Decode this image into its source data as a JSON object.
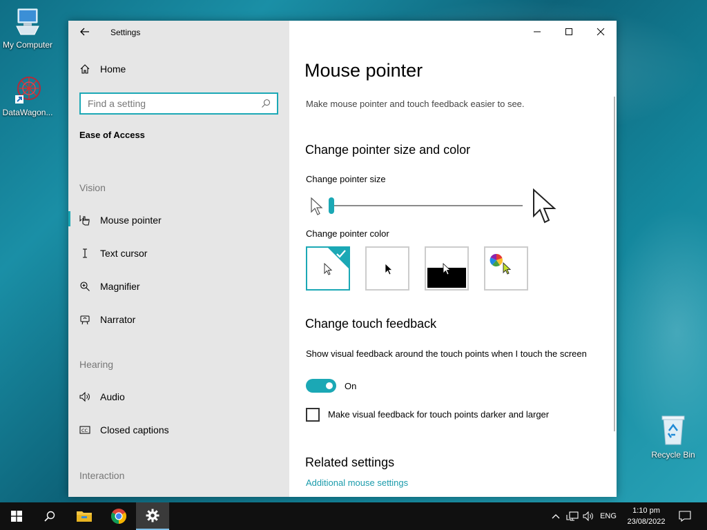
{
  "desktop": {
    "icons": [
      {
        "label": "My Computer"
      },
      {
        "label": "DataWagon..."
      },
      {
        "label": "Recycle Bin"
      }
    ]
  },
  "window": {
    "app_title": "Settings",
    "sidebar": {
      "home_label": "Home",
      "search_placeholder": "Find a setting",
      "section_title": "Ease of Access",
      "groups": {
        "vision": "Vision",
        "hearing": "Hearing",
        "interaction": "Interaction"
      },
      "items": {
        "mouse_pointer": "Mouse pointer",
        "text_cursor": "Text cursor",
        "magnifier": "Magnifier",
        "narrator": "Narrator",
        "audio": "Audio",
        "closed_captions": "Closed captions"
      },
      "selected_item": "Mouse pointer"
    },
    "content": {
      "title": "Mouse pointer",
      "description": "Make mouse pointer and touch feedback easier to see.",
      "size_color_heading": "Change pointer size and color",
      "size_label": "Change pointer size",
      "size_level": 0.0,
      "color_label": "Change pointer color",
      "color_options": [
        "white",
        "black",
        "inverted",
        "custom"
      ],
      "selected_color": "white",
      "touch_heading": "Change touch feedback",
      "touch_desc": "Show visual feedback around the touch points when I touch the screen",
      "toggle_state": "On",
      "toggle_on": true,
      "checkbox_label": "Make visual feedback for touch points darker and larger",
      "checkbox_checked": false,
      "related_heading": "Related settings",
      "related_link": "Additional mouse settings"
    }
  },
  "taskbar": {
    "language": "ENG",
    "time": "1:10 pm",
    "date": "23/08/2022"
  },
  "colors": {
    "accent": "#1ba8b5",
    "sidebar_bg": "#e6e6e6",
    "taskbar_bg": "#101010"
  }
}
